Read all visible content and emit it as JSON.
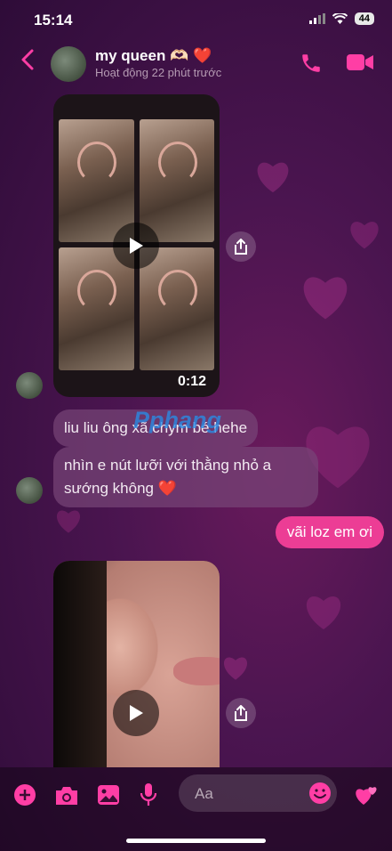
{
  "status_bar": {
    "time": "15:14",
    "battery": "44"
  },
  "header": {
    "contact_name": "my queen 🫶🏻 ❤️",
    "activity": "Hoạt động 22 phút trước"
  },
  "messages": {
    "video1": {
      "duration": "0:12"
    },
    "incoming1": "liu liu ông xã chym bé hehe",
    "incoming2": "nhìn e nút lưỡi với thằng nhỏ a sướng không ❤️",
    "outgoing1": "vãi loz em ơi"
  },
  "watermark": "Pphang",
  "composer": {
    "placeholder": "Aa"
  },
  "colors": {
    "accent": "#ec3d95",
    "icon": "#ff3ea5"
  }
}
